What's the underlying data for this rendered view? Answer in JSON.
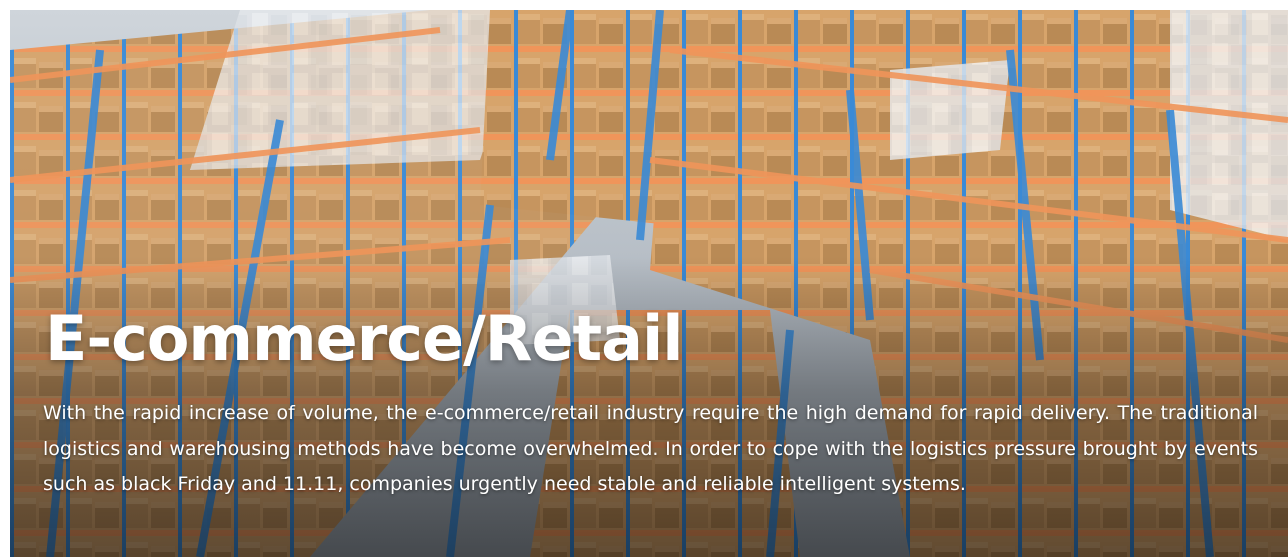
{
  "hero": {
    "title": "E-commerce/Retail",
    "description": "With the rapid increase of volume, the e-commerce/retail industry require the high demand for rapid delivery. The traditional logistics and warehousing methods have become overwhelmed. In order to cope with the logistics pressure brought by events such as black Friday and 11.11, companies urgently need stable and reliable intelligent systems."
  },
  "colors": {
    "rack_upright": "#3a8ad6",
    "rack_beam": "#f0955a",
    "box": "#c79a62",
    "box_light": "#e9ecef",
    "floor": "#b6bec7",
    "text": "#ffffff"
  }
}
